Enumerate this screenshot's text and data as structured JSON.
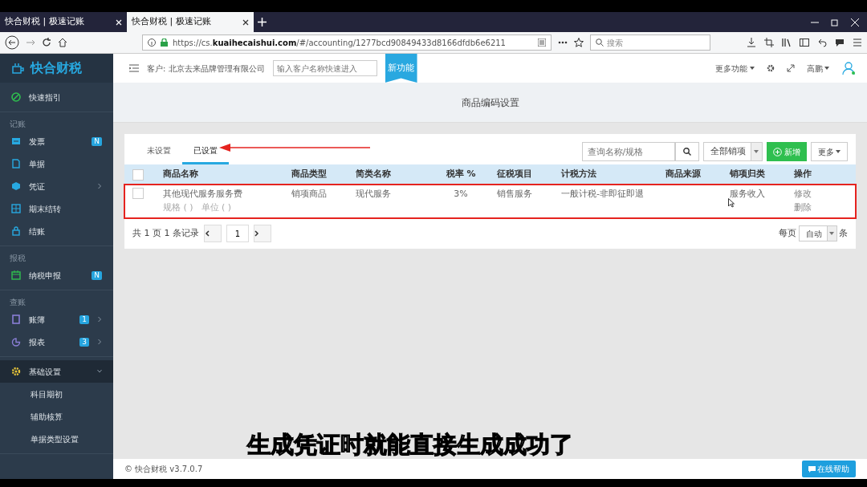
{
  "browser": {
    "tabs": [
      {
        "title": "快合财税 | 极速记账",
        "selected": false
      },
      {
        "title": "快合财税 | 极速记账",
        "selected": true
      }
    ],
    "url_prefix": "https://cs.",
    "url_host": "kuaihecaishui.com",
    "url_rest": "/#/accounting/1277bcd90849433d8166dfdb6e6211",
    "search_placeholder": "搜索"
  },
  "app": {
    "logo": "快合财税",
    "customer": "客户: 北京去来品牌管理有限公司",
    "customer_placeholder": "输入客户名称快速进入",
    "new_feature": "新功能",
    "more_functions": "更多功能",
    "user": "高鹏"
  },
  "sidebar": {
    "sections": [
      {
        "items": [
          {
            "label": "快速指引",
            "selected": false
          }
        ]
      },
      {
        "label": "记账",
        "items": [
          {
            "label": "发票",
            "badge": "N",
            "selected": false
          },
          {
            "label": "单据",
            "selected": false
          },
          {
            "label": "凭证",
            "chevron": true,
            "selected": false
          },
          {
            "label": "期末结转",
            "selected": false
          },
          {
            "label": "结账",
            "selected": false
          }
        ]
      },
      {
        "label": "报税",
        "items": [
          {
            "label": "纳税申报",
            "badge": "N",
            "selected": false
          }
        ]
      },
      {
        "label": "查账",
        "items": [
          {
            "label": "账簿",
            "badge": "1",
            "chevron": true,
            "selected": false
          },
          {
            "label": "报表",
            "badge": "3",
            "chevron": true,
            "selected": false
          }
        ]
      },
      {
        "items": [
          {
            "label": "基础设置",
            "expanded": true,
            "selected": true,
            "children": [
              {
                "label": "科目期初"
              },
              {
                "label": "辅助核算"
              },
              {
                "label": "单据类型设置"
              }
            ]
          }
        ]
      }
    ]
  },
  "page_title": "商品编码设置",
  "tabs": [
    {
      "label": "未设置",
      "selected": false
    },
    {
      "label": "已设置",
      "selected": true
    }
  ],
  "search_placeholder": "查询名称/规格",
  "filter": "全部销项",
  "add_button": "新增",
  "more_button": "更多",
  "table": {
    "all_checked": false,
    "columns": [
      "商品名称",
      "商品类型",
      "简类名称",
      "税率 %",
      "征税项目",
      "计税方法",
      "商品来源",
      "销项归类",
      "操作"
    ],
    "rows": [
      {
        "checked": false,
        "highlighted": true,
        "name": "其他现代服务服务费",
        "spec": "规格 ( )",
        "unit": "单位 ( )",
        "type": "销项商品",
        "short_name": "现代服务",
        "rate": "3%",
        "tax_item": "销售服务",
        "method": "一般计税-非即征即退",
        "category": "服务收入",
        "actions": [
          "修改",
          "删除"
        ]
      }
    ]
  },
  "pagination": {
    "summary": "共 1 页 1 条记录",
    "page": "1",
    "per_page_label": "每页",
    "per_page": "自动",
    "per_page_suffix": "条"
  },
  "footer": "© 快合财税 v3.7.0.7",
  "help_button": "在线帮助",
  "subtitle": "生成凭证时就能直接生成成功了"
}
